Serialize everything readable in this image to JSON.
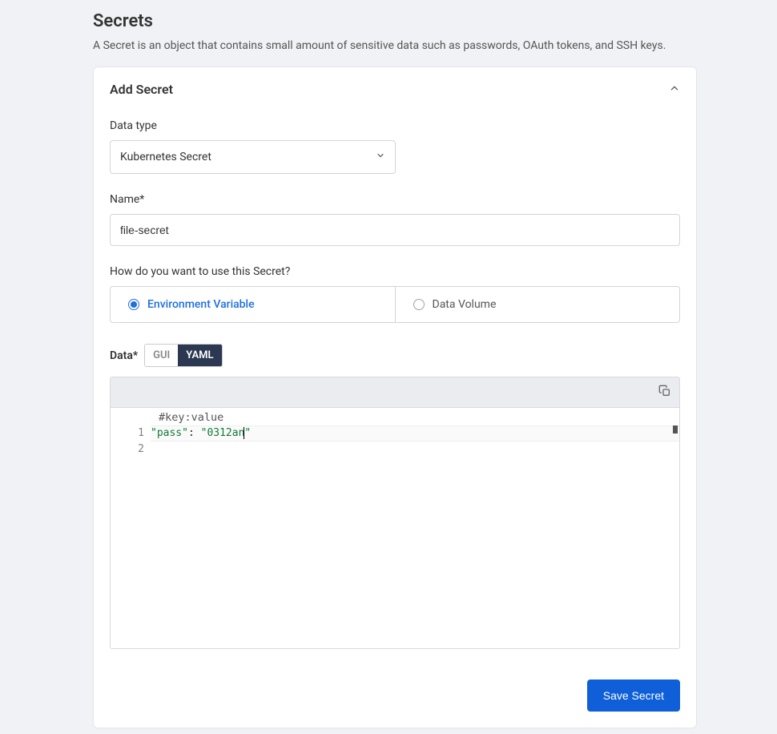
{
  "page": {
    "title": "Secrets",
    "description": "A Secret is an object that contains small amount of sensitive data such as passwords, OAuth tokens, and SSH keys."
  },
  "card": {
    "title": "Add Secret",
    "data_type_label": "Data type",
    "data_type_value": "Kubernetes Secret",
    "name_label": "Name*",
    "name_value": "file-secret",
    "usage_label": "How do you want to use this Secret?",
    "usage_options": [
      {
        "label": "Environment Variable",
        "selected": true
      },
      {
        "label": "Data Volume",
        "selected": false
      }
    ],
    "data_label": "Data*",
    "editor_toggle": {
      "gui": "GUI",
      "yaml": "YAML",
      "active": "yaml"
    },
    "editor_placeholder": "#key:value",
    "editor": {
      "line_numbers": [
        "1",
        "2"
      ],
      "line1_key": "\"pass\"",
      "line1_sep": ": ",
      "line1_val_open": "\"",
      "line1_val_body": "0312an",
      "line1_val_close": "\""
    },
    "save_label": "Save Secret"
  }
}
